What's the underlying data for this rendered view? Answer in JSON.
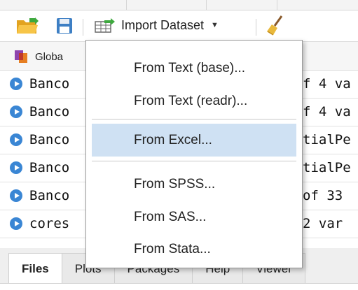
{
  "toolbar": {
    "import_label": "Import Dataset",
    "icons": [
      "open-folder-icon",
      "save-icon",
      "import-table-icon",
      "dropdown-caret-icon",
      "broom-icon"
    ]
  },
  "environment": {
    "scope_label": "Globa"
  },
  "objects": [
    {
      "name": "Banco",
      "value": "f 4 va"
    },
    {
      "name": "Banco",
      "value": "f 4 va"
    },
    {
      "name": "Banco",
      "value": "tialPe"
    },
    {
      "name": "Banco",
      "value": "tialPe"
    },
    {
      "name": "Banco",
      "value": "of 33"
    },
    {
      "name": "cores",
      "value": " 2 var"
    }
  ],
  "menu": {
    "items": [
      {
        "label": "From Text (base)..."
      },
      {
        "label": "From Text (readr)..."
      },
      {
        "label": "From Excel..."
      },
      {
        "label": "From SPSS..."
      },
      {
        "label": "From SAS..."
      },
      {
        "label": "From Stata..."
      }
    ],
    "highlighted_index": 2
  },
  "bottom_tabs": [
    {
      "label": "Files",
      "active": true
    },
    {
      "label": "Plots",
      "active": false
    },
    {
      "label": "Packages",
      "active": false
    },
    {
      "label": "Help",
      "active": false
    },
    {
      "label": "Viewer",
      "active": false
    }
  ],
  "colors": {
    "highlight": "#cfe1f3",
    "object_icon": "#3a86d4",
    "folder": "#f2b632",
    "save": "#3d7fc4"
  }
}
